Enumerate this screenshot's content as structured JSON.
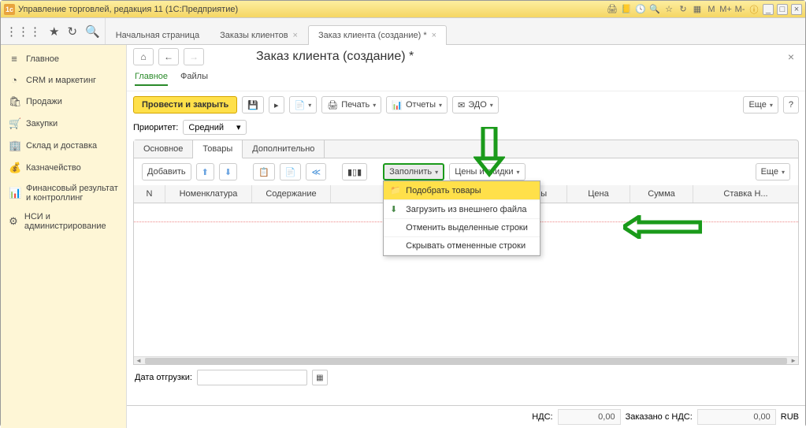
{
  "titlebar": {
    "logo": "1c",
    "text": "Управление торговлей, редакция 11  (1С:Предприятие)"
  },
  "topbar_tabs": [
    {
      "label": "Начальная страница",
      "active": false
    },
    {
      "label": "Заказы клиентов",
      "active": false
    },
    {
      "label": "Заказ клиента (создание) *",
      "active": true
    }
  ],
  "sidebar": [
    {
      "icon": "≡",
      "label": "Главное"
    },
    {
      "icon": "◔",
      "label": "CRM и маркетинг"
    },
    {
      "icon": "🛍",
      "label": "Продажи"
    },
    {
      "icon": "🛒",
      "label": "Закупки"
    },
    {
      "icon": "🏢",
      "label": "Склад и доставка"
    },
    {
      "icon": "💰",
      "label": "Казначейство"
    },
    {
      "icon": "📊",
      "label": "Финансовый результат и контроллинг"
    },
    {
      "icon": "⚙",
      "label": "НСИ и администрирование"
    }
  ],
  "page": {
    "title": "Заказ клиента (создание) *"
  },
  "subtabs": {
    "main": "Главное",
    "files": "Файлы"
  },
  "toolbar": {
    "post_close": "Провести и закрыть",
    "print": "Печать",
    "reports": "Отчеты",
    "edo": "ЭДО",
    "more": "Еще",
    "help": "?"
  },
  "priority": {
    "label": "Приоритет:",
    "value": "Средний"
  },
  "inner_tabs": {
    "main": "Основное",
    "goods": "Товары",
    "extra": "Дополнительно"
  },
  "toolbar2": {
    "add": "Добавить",
    "fill": "Заполнить",
    "prices": "Цены и скидки",
    "more": "Еще"
  },
  "fill_menu": {
    "pick": "Подобрать товары",
    "load": "Загрузить из внешнего файла",
    "cancel_sel": "Отменить выделенные строки",
    "hide_cancelled": "Скрывать отмененные строки"
  },
  "columns": {
    "n": "N",
    "nomen": "Номенклатура",
    "content": "Содержание",
    "pricetype": "Вид цены",
    "price": "Цена",
    "sum": "Сумма",
    "vat": "Ставка Н..."
  },
  "ship": {
    "label": "Дата отгрузки:"
  },
  "footer": {
    "nds_label": "НДС:",
    "nds_value": "0,00",
    "ordered_label": "Заказано с НДС:",
    "ordered_value": "0,00",
    "currency": "RUB"
  }
}
